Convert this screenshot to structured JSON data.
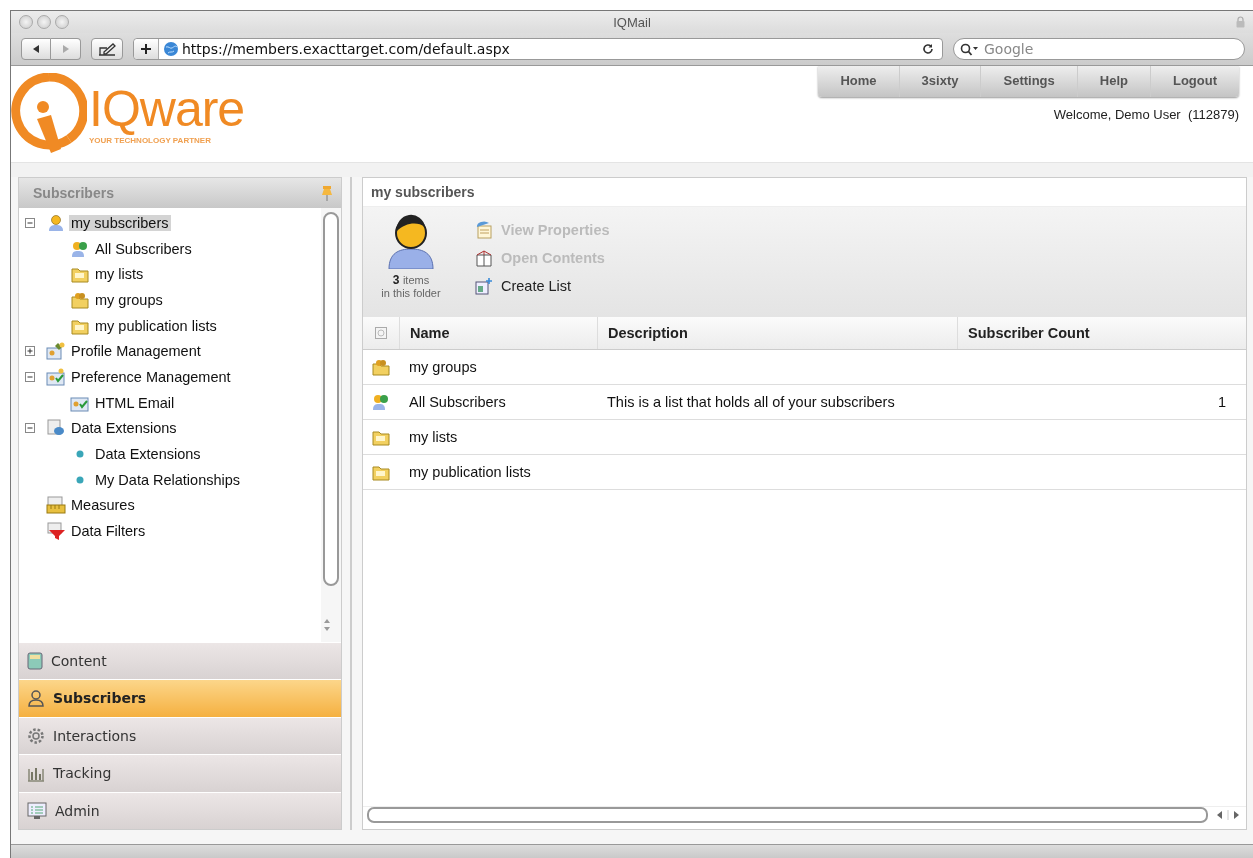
{
  "window": {
    "title": "IQMail"
  },
  "toolbar": {
    "url": "https://members.exacttarget.com/default.aspx",
    "search_placeholder": "Google"
  },
  "logo": {
    "name": "IQware",
    "tagline": "YOUR TECHNOLOGY PARTNER"
  },
  "nav": [
    "Home",
    "3sixty",
    "Settings",
    "Help",
    "Logout"
  ],
  "welcome": "Welcome, Demo User  (112879)",
  "sidebar": {
    "title": "Subscribers",
    "tree": [
      {
        "label": "my subscribers",
        "kind": "person",
        "expanded": true,
        "selected": true,
        "children": [
          {
            "label": "All Subscribers",
            "kind": "group",
            "selected": false
          },
          {
            "label": "my lists",
            "kind": "folder",
            "selected": false
          },
          {
            "label": "my groups",
            "kind": "folder-group",
            "selected": false
          },
          {
            "label": "my publication lists",
            "kind": "folder",
            "selected": false
          }
        ]
      },
      {
        "label": "Profile Management",
        "kind": "profile",
        "expanded": false,
        "selected": false
      },
      {
        "label": "Preference Management",
        "kind": "preference",
        "expanded": true,
        "selected": false,
        "children": [
          {
            "label": "HTML Email",
            "kind": "preference",
            "selected": false
          }
        ]
      },
      {
        "label": "Data Extensions",
        "kind": "database",
        "expanded": true,
        "selected": false,
        "children": [
          {
            "label": "Data Extensions",
            "kind": "bullet",
            "selected": false
          },
          {
            "label": "My Data Relationships",
            "kind": "bullet",
            "selected": false
          }
        ]
      },
      {
        "label": "Measures",
        "kind": "measures",
        "selected": false
      },
      {
        "label": "Data Filters",
        "kind": "filter",
        "selected": false
      }
    ],
    "sections": [
      {
        "label": "Content",
        "kind": "content",
        "selected": false
      },
      {
        "label": "Subscribers",
        "kind": "person",
        "selected": true
      },
      {
        "label": "Interactions",
        "kind": "gear",
        "selected": false
      },
      {
        "label": "Tracking",
        "kind": "chart",
        "selected": false
      },
      {
        "label": "Admin",
        "kind": "monitor",
        "selected": false
      }
    ]
  },
  "main": {
    "title": "my subscribers",
    "folder": {
      "count": "3",
      "unit": "items",
      "caption": "in this folder"
    },
    "actions": [
      {
        "label": "View Properties",
        "kind": "properties",
        "disabled": true
      },
      {
        "label": "Open Contents",
        "kind": "open",
        "disabled": true
      },
      {
        "label": "Create List",
        "kind": "create",
        "disabled": false
      }
    ],
    "table": {
      "select_all_checked": false,
      "columns": [
        "Name",
        "Description",
        "Subscriber Count"
      ],
      "rows": [
        {
          "kind": "folder-group",
          "name": "my groups"
        },
        {
          "kind": "group",
          "name": "All Subscribers",
          "description": "This is a list that holds all of your subscribers",
          "count": "1"
        },
        {
          "kind": "folder",
          "name": "my lists"
        },
        {
          "kind": "folder",
          "name": "my publication lists"
        }
      ]
    }
  }
}
